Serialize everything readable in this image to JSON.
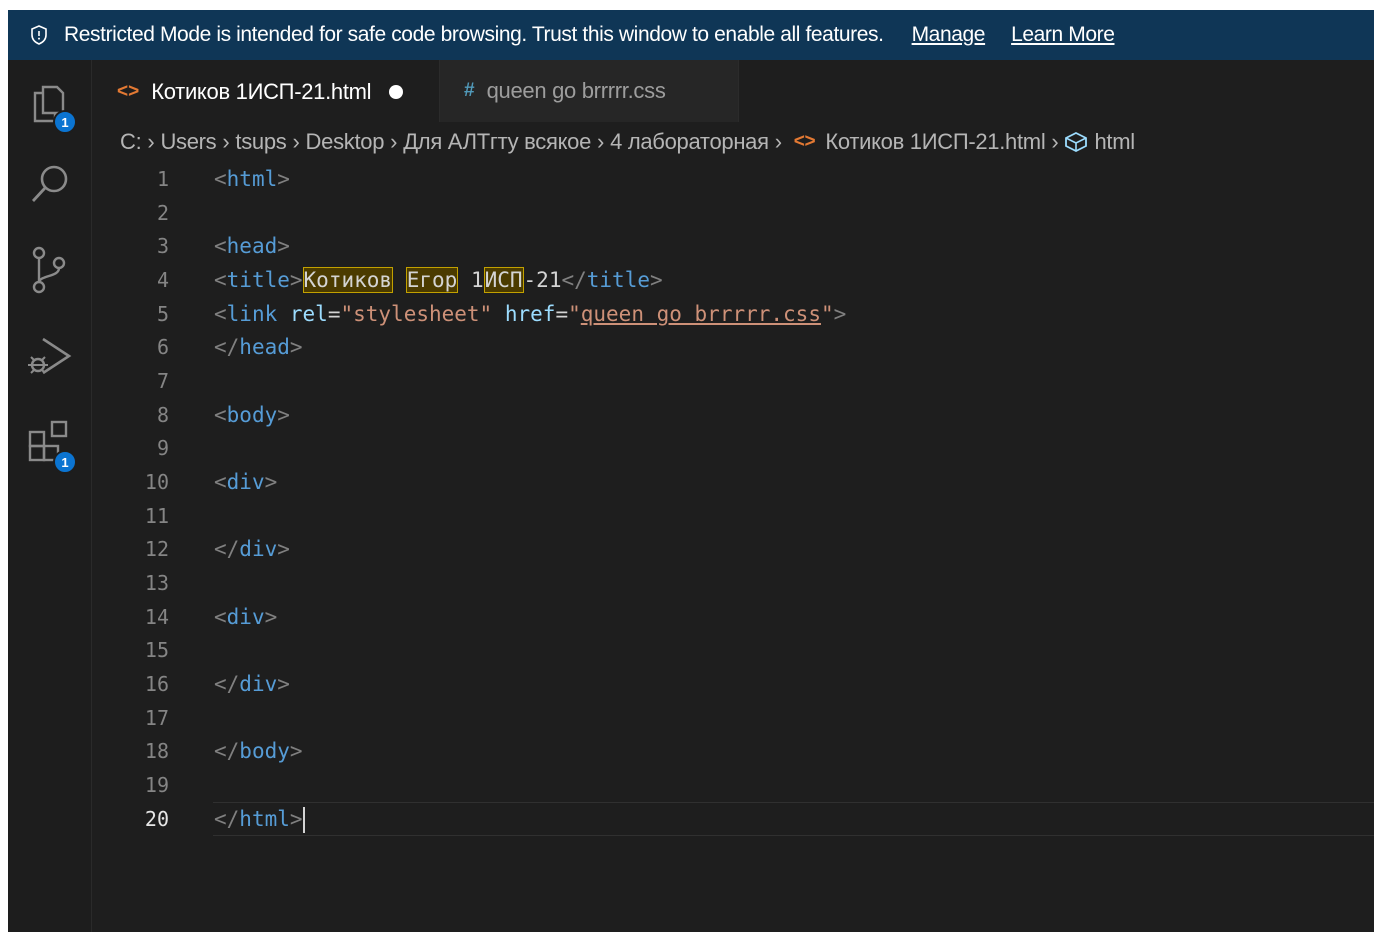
{
  "banner": {
    "message": "Restricted Mode is intended for safe code browsing. Trust this window to enable all features.",
    "manage_label": "Manage",
    "learn_more_label": "Learn More",
    "icon": "shield-icon",
    "background": "#0f3656"
  },
  "activity_bar": {
    "items": [
      {
        "name": "explorer",
        "icon": "files-icon",
        "badge": "1"
      },
      {
        "name": "search",
        "icon": "search-icon"
      },
      {
        "name": "source-control",
        "icon": "source-control-icon"
      },
      {
        "name": "run-debug",
        "icon": "run-debug-icon"
      },
      {
        "name": "extensions",
        "icon": "extensions-icon",
        "badge": "1"
      }
    ],
    "badge_color": "#0b74d1"
  },
  "tabs": [
    {
      "icon": "<>",
      "label": "Котиков 1ИСП-21.html",
      "active": true,
      "dirty": true
    },
    {
      "icon": "#",
      "label": "queen go brrrrr.css",
      "active": false,
      "dirty": false
    }
  ],
  "breadcrumb": {
    "items": [
      "C:",
      "Users",
      "tsups",
      "Desktop",
      "Для АЛТгту всякое",
      "4 лабораторная",
      "Котиков 1ИСП-21.html",
      "html"
    ]
  },
  "editor": {
    "current_line": 20,
    "lines": [
      {
        "n": "1"
      },
      {
        "n": "2"
      },
      {
        "n": "3"
      },
      {
        "n": "4"
      },
      {
        "n": "5"
      },
      {
        "n": "6"
      },
      {
        "n": "7"
      },
      {
        "n": "8"
      },
      {
        "n": "9"
      },
      {
        "n": "10"
      },
      {
        "n": "11"
      },
      {
        "n": "12"
      },
      {
        "n": "13"
      },
      {
        "n": "14"
      },
      {
        "n": "15"
      },
      {
        "n": "16"
      },
      {
        "n": "17"
      },
      {
        "n": "18"
      },
      {
        "n": "19"
      },
      {
        "n": "20"
      }
    ],
    "code": {
      "l1_tag": "html",
      "l3_tag": "head",
      "l4_tag": "title",
      "l4_w1": "Котиков",
      "l4_w2": "Егор",
      "l4_w3a": "1",
      "l4_w3b": "ИСП",
      "l4_w3c": "-21",
      "l5_tag": "link",
      "l5_attr1": "rel",
      "l5_val1": "\"stylesheet\"",
      "l5_attr2": "href",
      "l5_val2": "queen go brrrrr.css",
      "l6_tag": "head",
      "l8_tag": "body",
      "l10_tag": "div",
      "l12_tag": "div",
      "l14_tag": "div",
      "l16_tag": "div",
      "l18_tag": "body",
      "l20_tag": "html"
    }
  },
  "colors": {
    "editor_bg": "#1e1e1e",
    "tag_name": "#569cd6",
    "attr_name": "#9cdcfe",
    "attr_value": "#ce9178",
    "html_icon": "#e37933",
    "css_icon": "#519aba"
  }
}
